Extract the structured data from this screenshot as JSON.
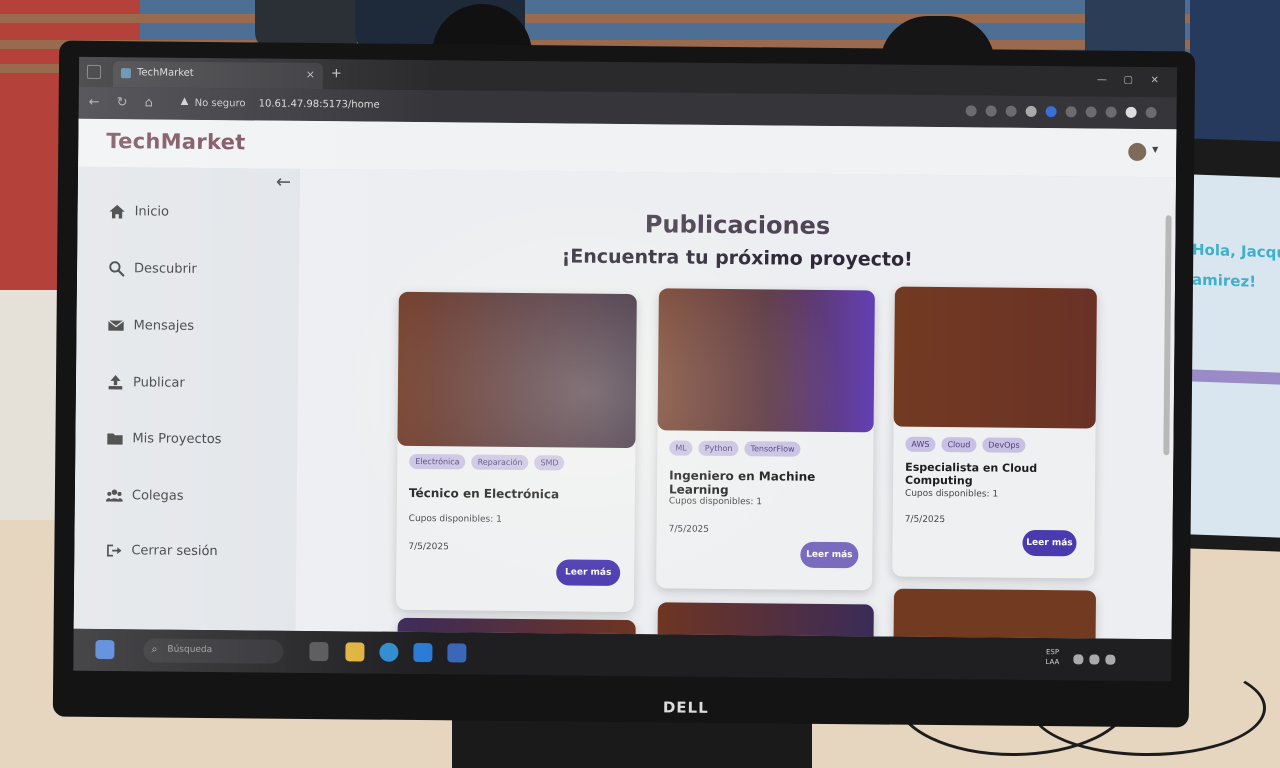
{
  "browser": {
    "tab_title": "TechMarket",
    "security_label": "No seguro",
    "url": "10.61.47.98:5173/home",
    "tab_close": "×",
    "tab_new": "+"
  },
  "app": {
    "brand": "TechMarket",
    "back_arrow": "←"
  },
  "sidebar": {
    "items": [
      {
        "label": "Inicio",
        "icon": "home-icon"
      },
      {
        "label": "Descubrir",
        "icon": "search-icon"
      },
      {
        "label": "Mensajes",
        "icon": "envelope-icon"
      },
      {
        "label": "Publicar",
        "icon": "upload-icon"
      },
      {
        "label": "Mis Proyectos",
        "icon": "folder-icon"
      },
      {
        "label": "Colegas",
        "icon": "users-icon"
      },
      {
        "label": "Cerrar sesión",
        "icon": "logout-icon"
      }
    ]
  },
  "main": {
    "title": "Publicaciones",
    "subtitle": "¡Encuentra tu próximo proyecto!",
    "cards": [
      {
        "tags": [
          "Electrónica",
          "Reparación",
          "SMD"
        ],
        "title": "Técnico en Electrónica",
        "slots": "Cupos disponibles: 1",
        "date": "7/5/2025",
        "button": "Leer más"
      },
      {
        "tags": [
          "ML",
          "Python",
          "TensorFlow"
        ],
        "title": "Ingeniero en Machine Learning",
        "slots": "Cupos disponibles: 1",
        "date": "7/5/2025",
        "button": "Leer más"
      },
      {
        "tags": [
          "AWS",
          "Cloud",
          "DevOps"
        ],
        "title": "Especialista en Cloud Computing",
        "slots": "Cupos disponibles: 1",
        "date": "7/5/2025",
        "button": "Leer más"
      }
    ]
  },
  "taskbar": {
    "search_placeholder": "Búsqueda",
    "lang_top": "ESP",
    "lang_bottom": "LAA"
  },
  "monitor": {
    "brand": "DELL"
  },
  "background_laptop": {
    "greeting_line1": "Hola, Jacqueli",
    "greeting_line2": "amirez!"
  },
  "colors": {
    "brand": "#7a4e58",
    "button": "#4a3ab0",
    "tag_bg": "#c9c1e4"
  }
}
